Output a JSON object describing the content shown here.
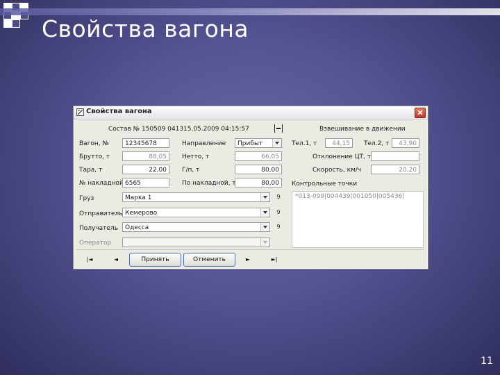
{
  "slide": {
    "title": "Свойства вагона",
    "page_number": "11"
  },
  "dialog": {
    "title": "Свойства вагона",
    "header": {
      "composition_label": "Состав №",
      "composition_value": "150509 0413",
      "datetime_value": "15.05.2009 04:15:57",
      "weighing_label": "Взвешивание в движении"
    },
    "wagon_label": "Вагон, №",
    "wagon_value": "12345678",
    "gross_label": "Брутто, т",
    "gross_value": "88,05",
    "tare_label": "Тара, т",
    "tare_value": "22,00",
    "waybill_label": "№ накладной",
    "waybill_value": "6565",
    "direction_label": "Направление",
    "direction_value": "Прибыт",
    "net_label": "Нетто, т",
    "net_value": "66,05",
    "capacity_label": "Г/п, т",
    "capacity_value": "80,00",
    "by_waybill_label": "По накладной, т",
    "by_waybill_value": "80,00",
    "truck1_label": "Тел.1, т",
    "truck1_value": "44,15",
    "truck2_label": "Тел.2, т",
    "truck2_value": "43,90",
    "cg_label": "Отклонение ЦТ, т",
    "cg_value": "",
    "speed_label": "Скорость, км/ч",
    "speed_value": "20,20",
    "checkpoints_label": "Контрольные точки",
    "checkpoints_value": "*013-099|004439|001050|005436|",
    "cargo_label": "Груз",
    "cargo_value": "Марка 1",
    "sender_label": "Отправитель",
    "sender_value": "Кемерово",
    "receiver_label": "Получатель",
    "receiver_value": "Одесса",
    "operator_label": "Оператор",
    "operator_value": "",
    "side_button_label": "9",
    "accept_label": "Принять",
    "cancel_label": "Отменить",
    "nav": {
      "first": "|◄",
      "prev": "◄",
      "next": "►",
      "last": "►|"
    }
  }
}
